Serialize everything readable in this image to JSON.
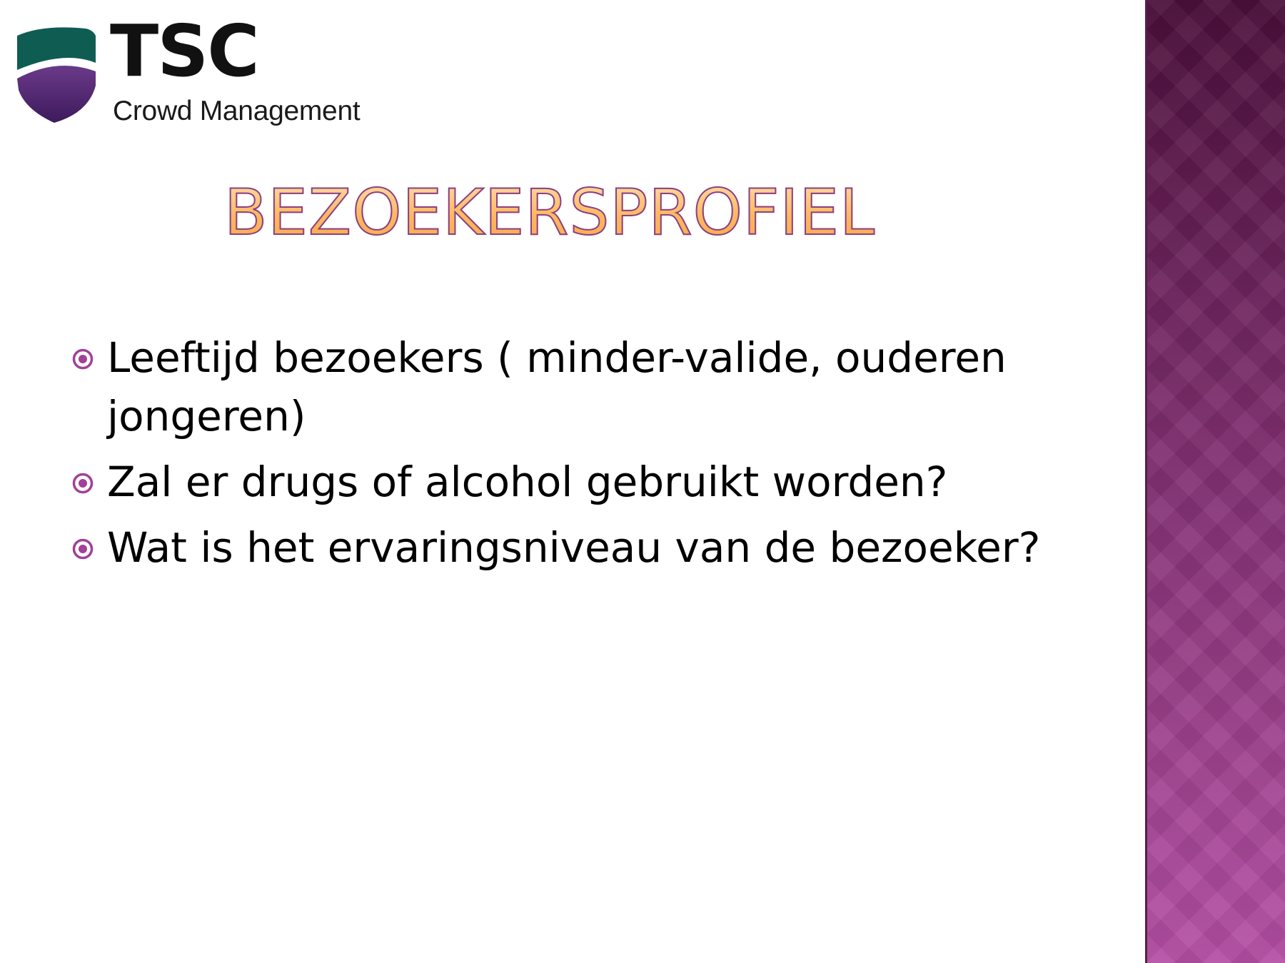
{
  "slide": {
    "logo": {
      "mark": "TSC",
      "subtitle": "Crowd Management",
      "icon": "shield-logo"
    },
    "title": "BEZOEKERSPROFIEL",
    "bullets": [
      {
        "icon": "circled-dot-bullet",
        "text": "Leeftijd bezoekers ( minder-valide, ouderen jongeren)"
      },
      {
        "icon": "circled-dot-bullet",
        "text": "Zal er drugs of alcohol gebruikt worden?"
      },
      {
        "icon": "circled-dot-bullet",
        "text": "Wat is het ervaringsniveau van de bezoeker?"
      }
    ]
  },
  "colors": {
    "title_fill": "#fbb860",
    "title_outline": "#8b3f86",
    "bullet_icon": "#a0419a",
    "band_top": "#4a0f3a",
    "band_mid": "#7e2e6e",
    "band_bottom": "#b44fa4",
    "shield_top": "#0f5d52",
    "shield_bottom": "#4a1d6a"
  }
}
